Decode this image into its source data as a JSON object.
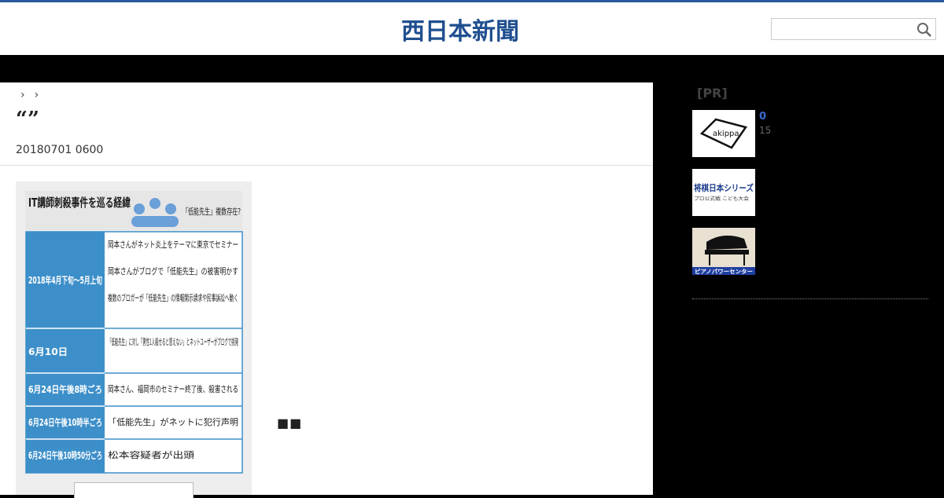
{
  "header": {
    "logo_text": "西日本新聞",
    "search": {
      "placeholder": "",
      "value": ""
    }
  },
  "breadcrumb": {
    "separators": [
      "›",
      "›"
    ]
  },
  "article": {
    "title": "“”",
    "date": "20180701 0600",
    "trailing_glyphs": "■■"
  },
  "infographic": {
    "heading": "IT講師刺殺事件を巡る経緯",
    "badge": "「低能先生」複数存在?",
    "rows": [
      {
        "date": "2018年4月下旬〜5月上旬",
        "items": [
          "岡本さんがネット炎上をテーマに東京でセミナー",
          "岡本さんがブログで「低能先生」の被害明かす",
          "複数のブロガーが「低能先生」の情報開示請求や民事訴訟へ動く"
        ]
      },
      {
        "date": "6月10日",
        "items": [
          "「低能先生」に対し「男性1人殺せると思えない」とネットユーザーがブログで挑発"
        ]
      },
      {
        "date": "6月24日午後8時ごろ",
        "items": [
          "岡本さん、福岡市のセミナー終了後、殺害される"
        ]
      },
      {
        "date": "6月24日午後10時半ごろ",
        "items": [
          "「低能先生」がネットに犯行声明"
        ]
      },
      {
        "date": "6月24日午後10時50分ごろ",
        "items": [
          "松本容疑者が出頭"
        ]
      }
    ]
  },
  "sidebar": {
    "pr_label": "[PR]",
    "ads": [
      {
        "name": "akippa",
        "count": "0",
        "sub": "15"
      },
      {
        "name": "将棋日本シリーズ",
        "sub_label": "プロ公式戦 こども大会"
      },
      {
        "name": "ピアノパワーセンター"
      }
    ]
  },
  "colors": {
    "brand_blue": "#2a5a9c",
    "infographic_blue": "#3d8fc9",
    "link_blue": "#3a6bd0"
  }
}
